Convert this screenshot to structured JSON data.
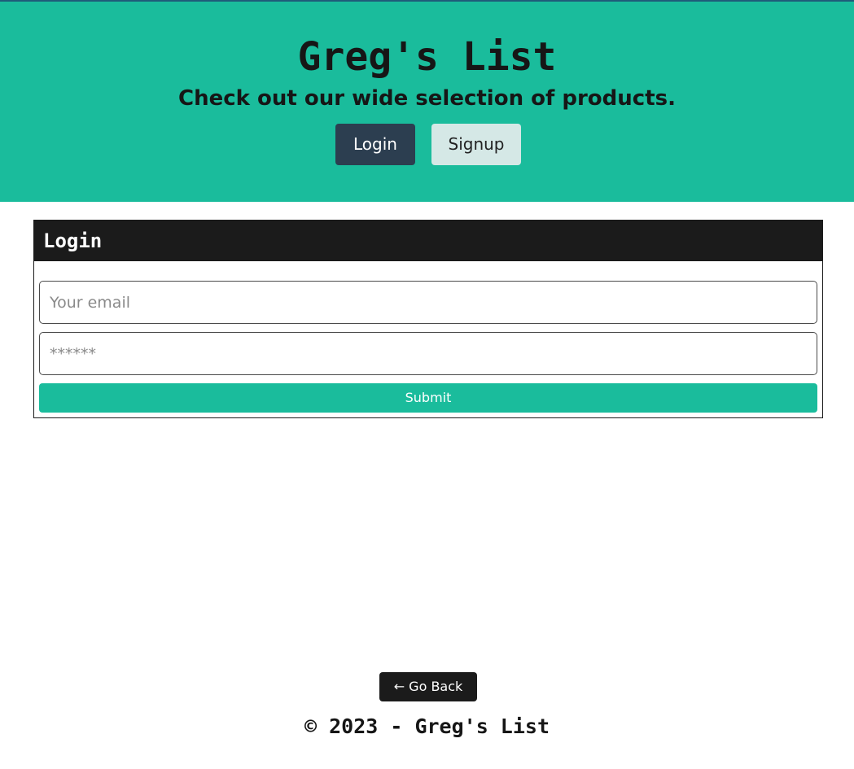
{
  "header": {
    "title": "Greg's List",
    "tagline": "Check out our wide selection of products.",
    "nav": {
      "login_label": "Login",
      "signup_label": "Signup"
    }
  },
  "login_card": {
    "title": "Login",
    "email_placeholder": "Your email",
    "password_placeholder": "******",
    "submit_label": "Submit"
  },
  "back_button": {
    "label": "← Go Back"
  },
  "footer": {
    "text": "© 2023 - Greg's List"
  },
  "colors": {
    "header_bg": "#1abc9c",
    "login_button_bg": "#2c3e50",
    "signup_button_bg": "#d5e8e6",
    "card_header_bg": "#1b1b1b",
    "submit_bg": "#1abc9c"
  }
}
